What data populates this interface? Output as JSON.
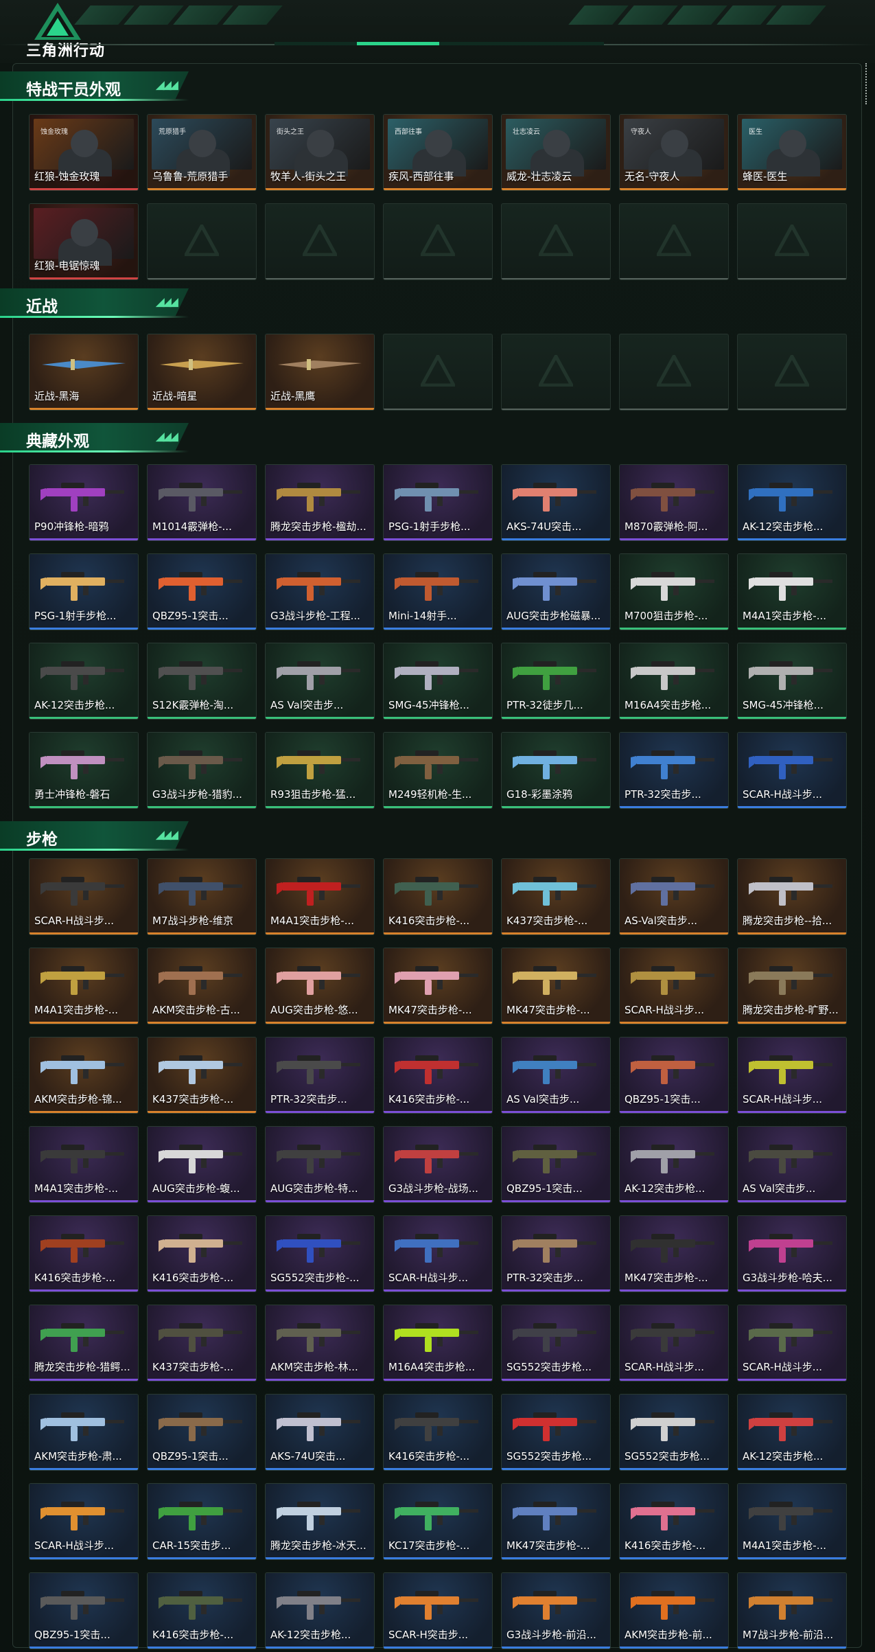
{
  "header": {
    "brand": "三角洲行动",
    "progress": 0.5
  },
  "sections": [
    {
      "title": "特战干员外观",
      "kind": "operator",
      "items": [
        {
          "label": "红狼-蚀金玫瑰",
          "q": "red",
          "tag": "蚀金玫瑰",
          "tint": "#6a3a18"
        },
        {
          "label": "乌鲁鲁-荒原猎手",
          "q": "gold",
          "tag": "荒原猎手",
          "tint": "#2c4a5a"
        },
        {
          "label": "牧羊人-街头之王",
          "q": "gold",
          "tag": "街头之王",
          "tint": "#38434c"
        },
        {
          "label": "疾风-西部往事",
          "q": "gold",
          "tag": "西部往事",
          "tint": "#2c6068"
        },
        {
          "label": "威龙-壮志凌云",
          "q": "gold",
          "tag": "壮志凌云",
          "tint": "#2c5c60"
        },
        {
          "label": "无名-守夜人",
          "q": "gold",
          "tag": "守夜人",
          "tint": "#3a3f44"
        },
        {
          "label": "蜂医-医生",
          "q": "gold",
          "tag": "医生",
          "tint": "#2a6068"
        },
        {
          "label": "红狼-电锯惊魂",
          "q": "red",
          "tag": "",
          "tint": "#5a1e22"
        },
        {
          "empty": true
        },
        {
          "empty": true
        },
        {
          "empty": true
        },
        {
          "empty": true
        },
        {
          "empty": true
        },
        {
          "empty": true
        }
      ]
    },
    {
      "title": "近战",
      "kind": "melee",
      "items": [
        {
          "label": "近战-黑海",
          "q": "gold",
          "tint": "#4a8ac8"
        },
        {
          "label": "近战-暗星",
          "q": "gold",
          "tint": "#c8a050"
        },
        {
          "label": "近战-黑鹰",
          "q": "gold",
          "tint": "#a08060"
        },
        {
          "empty": true
        },
        {
          "empty": true
        },
        {
          "empty": true
        },
        {
          "empty": true
        }
      ]
    },
    {
      "title": "典藏外观",
      "kind": "gun",
      "items": [
        {
          "label": "P90冲锋枪-暗鸦",
          "q": "purple",
          "tint": "#a040c0"
        },
        {
          "label": "M1014霰弹枪-...",
          "q": "purple",
          "tint": "#5a5a64"
        },
        {
          "label": "腾龙突击步枪-楹劫...",
          "q": "purple",
          "tint": "#b08a40"
        },
        {
          "label": "PSG-1射手步枪...",
          "q": "purple",
          "tint": "#7090b0"
        },
        {
          "label": "AKS-74U突击...",
          "q": "blue",
          "tint": "#e08070"
        },
        {
          "label": "M870霰弹枪-阿...",
          "q": "purple",
          "tint": "#805040"
        },
        {
          "label": "AK-12突击步枪...",
          "q": "blue",
          "tint": "#3070c0"
        },
        {
          "label": "PSG-1射手步枪...",
          "q": "blue",
          "tint": "#e0b060"
        },
        {
          "label": "QBZ95-1突击...",
          "q": "blue",
          "tint": "#e06030"
        },
        {
          "label": "G3战斗步枪-工程...",
          "q": "blue",
          "tint": "#d06030"
        },
        {
          "label": "Mini-14射手...",
          "q": "blue",
          "tint": "#c05a30"
        },
        {
          "label": "AUG突击步枪磁暴...",
          "q": "blue",
          "tint": "#7090d0"
        },
        {
          "label": "M700狙击步枪-...",
          "q": "green",
          "tint": "#d8d8d8"
        },
        {
          "label": "M4A1突击步枪-...",
          "q": "green",
          "tint": "#e0e0e0"
        },
        {
          "label": "AK-12突击步枪...",
          "q": "green",
          "tint": "#4a4a4a"
        },
        {
          "label": "S12K霰弹枪-淘...",
          "q": "green",
          "tint": "#505050"
        },
        {
          "label": "AS Val突击步...",
          "q": "green",
          "tint": "#a0a0a8"
        },
        {
          "label": "SMG-45冲锋枪...",
          "q": "green",
          "tint": "#b0b0c0"
        },
        {
          "label": "PTR-32徒步几...",
          "q": "green",
          "tint": "#40a040"
        },
        {
          "label": "M16A4突击步枪...",
          "q": "green",
          "tint": "#c8c8c8"
        },
        {
          "label": "SMG-45冲锋枪...",
          "q": "green",
          "tint": "#b0b0b0"
        },
        {
          "label": "勇士冲锋枪-磐石",
          "q": "green",
          "tint": "#c090c0"
        },
        {
          "label": "G3战斗步枪-猎豹...",
          "q": "green",
          "tint": "#6a5a4a"
        },
        {
          "label": "R93狙击步枪-猛...",
          "q": "green",
          "tint": "#c0a040"
        },
        {
          "label": "M249轻机枪-生...",
          "q": "green",
          "tint": "#806040"
        },
        {
          "label": "G18-彩墨涂鸦",
          "q": "green",
          "tint": "#70b0e0"
        },
        {
          "label": "PTR-32突击步...",
          "q": "blue",
          "tint": "#4080d0"
        },
        {
          "label": "SCAR-H战斗步...",
          "q": "blue",
          "tint": "#3060c0"
        }
      ]
    },
    {
      "title": "步枪",
      "kind": "gun",
      "items": [
        {
          "label": "SCAR-H战斗步...",
          "q": "gold",
          "tint": "#3a3a3a"
        },
        {
          "label": "M7战斗步枪-维京",
          "q": "gold",
          "tint": "#40506a"
        },
        {
          "label": "M4A1突击步枪-...",
          "q": "gold",
          "tint": "#c02020"
        },
        {
          "label": "K416突击步枪-...",
          "q": "gold",
          "tint": "#406050"
        },
        {
          "label": "K437突击步枪-...",
          "q": "gold",
          "tint": "#70c0d8"
        },
        {
          "label": "AS-Val突击步...",
          "q": "gold",
          "tint": "#6070a0"
        },
        {
          "label": "腾龙突击步枪--拾...",
          "q": "gold",
          "tint": "#c0c0c8"
        },
        {
          "label": "M4A1突击步枪-...",
          "q": "gold",
          "tint": "#c0a040"
        },
        {
          "label": "AKM突击步枪-古...",
          "q": "gold",
          "tint": "#a07050"
        },
        {
          "label": "AUG突击步枪-悠...",
          "q": "gold",
          "tint": "#e0a0a0"
        },
        {
          "label": "MK47突击步枪-...",
          "q": "gold",
          "tint": "#e0a0b0"
        },
        {
          "label": "MK47突击步枪-...",
          "q": "gold",
          "tint": "#d0b060"
        },
        {
          "label": "SCAR-H战斗步...",
          "q": "gold",
          "tint": "#b09040"
        },
        {
          "label": "腾龙突击步枪-旷野...",
          "q": "gold",
          "tint": "#8a7a5a"
        },
        {
          "label": "AKM突击步枪-锦...",
          "q": "gold",
          "tint": "#a0c0e0"
        },
        {
          "label": "K437突击步枪-...",
          "q": "gold",
          "tint": "#b0c8e0"
        },
        {
          "label": "PTR-32突击步...",
          "q": "purple",
          "tint": "#4a4a4a"
        },
        {
          "label": "K416突击步枪-...",
          "q": "purple",
          "tint": "#c03030"
        },
        {
          "label": "AS Val突击步...",
          "q": "purple",
          "tint": "#4080c0"
        },
        {
          "label": "QBZ95-1突击...",
          "q": "purple",
          "tint": "#c06040"
        },
        {
          "label": "SCAR-H战斗步...",
          "q": "purple",
          "tint": "#c0c030"
        },
        {
          "label": "M4A1突击步枪-...",
          "q": "purple",
          "tint": "#3a3a3a"
        },
        {
          "label": "AUG突击步枪-蝮...",
          "q": "purple",
          "tint": "#d8d8d8"
        },
        {
          "label": "AUG突击步枪-特...",
          "q": "purple",
          "tint": "#404040"
        },
        {
          "label": "G3战斗步枪-战场...",
          "q": "purple",
          "tint": "#c04040"
        },
        {
          "label": "QBZ95-1突击...",
          "q": "purple",
          "tint": "#606040"
        },
        {
          "label": "AK-12突击步枪...",
          "q": "purple",
          "tint": "#a0a0a8"
        },
        {
          "label": "AS Val突击步...",
          "q": "purple",
          "tint": "#4a4a40"
        },
        {
          "label": "K416突击步枪-...",
          "q": "purple",
          "tint": "#a04020"
        },
        {
          "label": "K416突击步枪-...",
          "q": "purple",
          "tint": "#d0b090"
        },
        {
          "label": "SG552突击步枪-...",
          "q": "purple",
          "tint": "#3050c0"
        },
        {
          "label": "SCAR-H战斗步...",
          "q": "purple",
          "tint": "#4070c0"
        },
        {
          "label": "PTR-32突击步...",
          "q": "purple",
          "tint": "#a08060"
        },
        {
          "label": "MK47突击步枪-...",
          "q": "purple",
          "tint": "#303030"
        },
        {
          "label": "G3战斗步枪-哈夫...",
          "q": "purple",
          "tint": "#c04090"
        },
        {
          "label": "腾龙突击步枪-猎鳄...",
          "q": "purple",
          "tint": "#40a050"
        },
        {
          "label": "K437突击步枪-...",
          "q": "purple",
          "tint": "#505040"
        },
        {
          "label": "AKM突击步枪-林...",
          "q": "purple",
          "tint": "#606050"
        },
        {
          "label": "M16A4突击步枪...",
          "q": "purple",
          "tint": "#b0e020"
        },
        {
          "label": "SG552突击步枪...",
          "q": "purple",
          "tint": "#404048"
        },
        {
          "label": "SCAR-H战斗步...",
          "q": "purple",
          "tint": "#3a3a3a"
        },
        {
          "label": "SCAR-H战斗步...",
          "q": "purple",
          "tint": "#5a6a4a"
        },
        {
          "label": "AKM突击步枪-肃...",
          "q": "blue",
          "tint": "#a0c0e0"
        },
        {
          "label": "QBZ95-1突击...",
          "q": "blue",
          "tint": "#8a6a4a"
        },
        {
          "label": "AKS-74U突击...",
          "q": "blue",
          "tint": "#c0c0d0"
        },
        {
          "label": "K416突击步枪-...",
          "q": "blue",
          "tint": "#404040"
        },
        {
          "label": "SG552突击步枪...",
          "q": "blue",
          "tint": "#d03030"
        },
        {
          "label": "SG552突击步枪...",
          "q": "blue",
          "tint": "#d0d0d0"
        },
        {
          "label": "AK-12突击步枪...",
          "q": "blue",
          "tint": "#d04040"
        },
        {
          "label": "SCAR-H战斗步...",
          "q": "blue",
          "tint": "#e09030"
        },
        {
          "label": "CAR-15突击步...",
          "q": "blue",
          "tint": "#40a040"
        },
        {
          "label": "腾龙突击步枪-冰天...",
          "q": "blue",
          "tint": "#c0d0e0"
        },
        {
          "label": "KC17突击步枪-...",
          "q": "blue",
          "tint": "#40b060"
        },
        {
          "label": "MK47突击步枪-...",
          "q": "blue",
          "tint": "#6080c0"
        },
        {
          "label": "K416突击步枪-...",
          "q": "blue",
          "tint": "#e07090"
        },
        {
          "label": "M4A1突击步枪-...",
          "q": "blue",
          "tint": "#404040"
        },
        {
          "label": "QBZ95-1突击...",
          "q": "blue",
          "tint": "#5a5a5a"
        },
        {
          "label": "K416突击步枪-...",
          "q": "blue",
          "tint": "#506040"
        },
        {
          "label": "AK-12突击步枪...",
          "q": "blue",
          "tint": "#808088"
        },
        {
          "label": "SCAR-H突击步...",
          "q": "blue",
          "tint": "#e08030"
        },
        {
          "label": "G3战斗步枪-前沿...",
          "q": "blue",
          "tint": "#e08030"
        },
        {
          "label": "AKM突击步枪-前...",
          "q": "blue",
          "tint": "#e07020"
        },
        {
          "label": "M7战斗步枪-前沿...",
          "q": "blue",
          "tint": "#d08030"
        }
      ]
    }
  ]
}
